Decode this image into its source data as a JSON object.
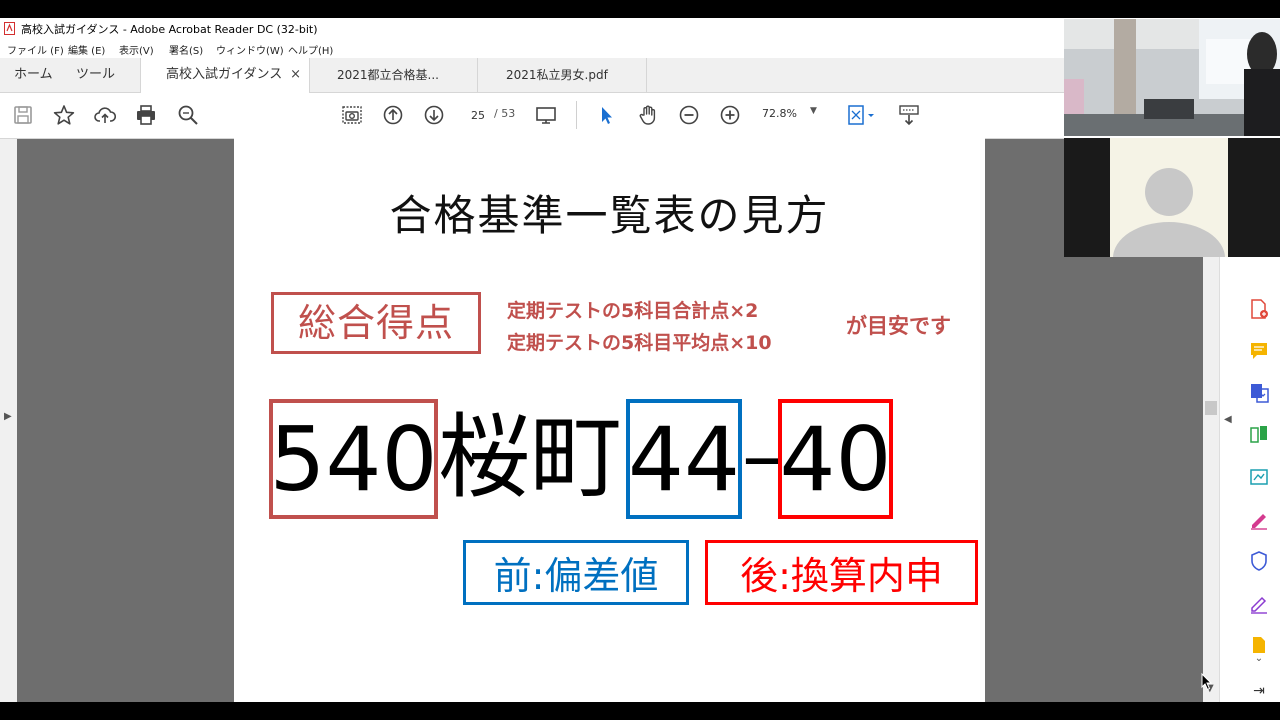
{
  "window": {
    "title": "高校入試ガイダンス - Adobe Acrobat Reader DC (32-bit)"
  },
  "menu": [
    "ファイル (F)",
    "編集 (E)",
    "表示(V)",
    "署名(S)",
    "ウィンドウ(W)",
    "ヘルプ(H)"
  ],
  "tabs": {
    "home": "ホーム",
    "tools": "ツール",
    "documents": [
      {
        "label": "高校入試ガイダンス",
        "active": true,
        "close": "×"
      },
      {
        "label": "2021都立合格基...",
        "active": false
      },
      {
        "label": "2021私立男女.pdf",
        "active": false
      }
    ]
  },
  "toolbar": {
    "page_current": "25",
    "page_total": "/ 53",
    "zoom": "72.8%"
  },
  "icons": {
    "save": "save-icon",
    "bookmark": "star-icon",
    "upload": "cloud-upload-icon",
    "print": "printer-icon",
    "search": "search-icon",
    "snapshot": "camera-icon",
    "prev": "arrow-up-circle-icon",
    "next": "arrow-down-circle-icon",
    "display": "monitor-icon",
    "select": "cursor-arrow-icon",
    "hand": "hand-icon",
    "zoom_out": "zoom-out-icon",
    "zoom_in": "zoom-in-icon"
  },
  "slide": {
    "heading": "合格基準一覧表の見方",
    "score_label": "総合得点",
    "formula_line1": "定期テストの5科目合計点×2",
    "formula_line2": "定期テストの5科目平均点×10",
    "formula_suffix": "が目安です",
    "total_score": "540",
    "school_name": "桜町",
    "deviation": "44",
    "dash": "–",
    "naishin": "40",
    "legend_front": "前:偏差値",
    "legend_back": "後:換算内申"
  },
  "colors": {
    "score_red": "#c0504d",
    "blue": "#0070c0",
    "red": "#ff0000"
  }
}
